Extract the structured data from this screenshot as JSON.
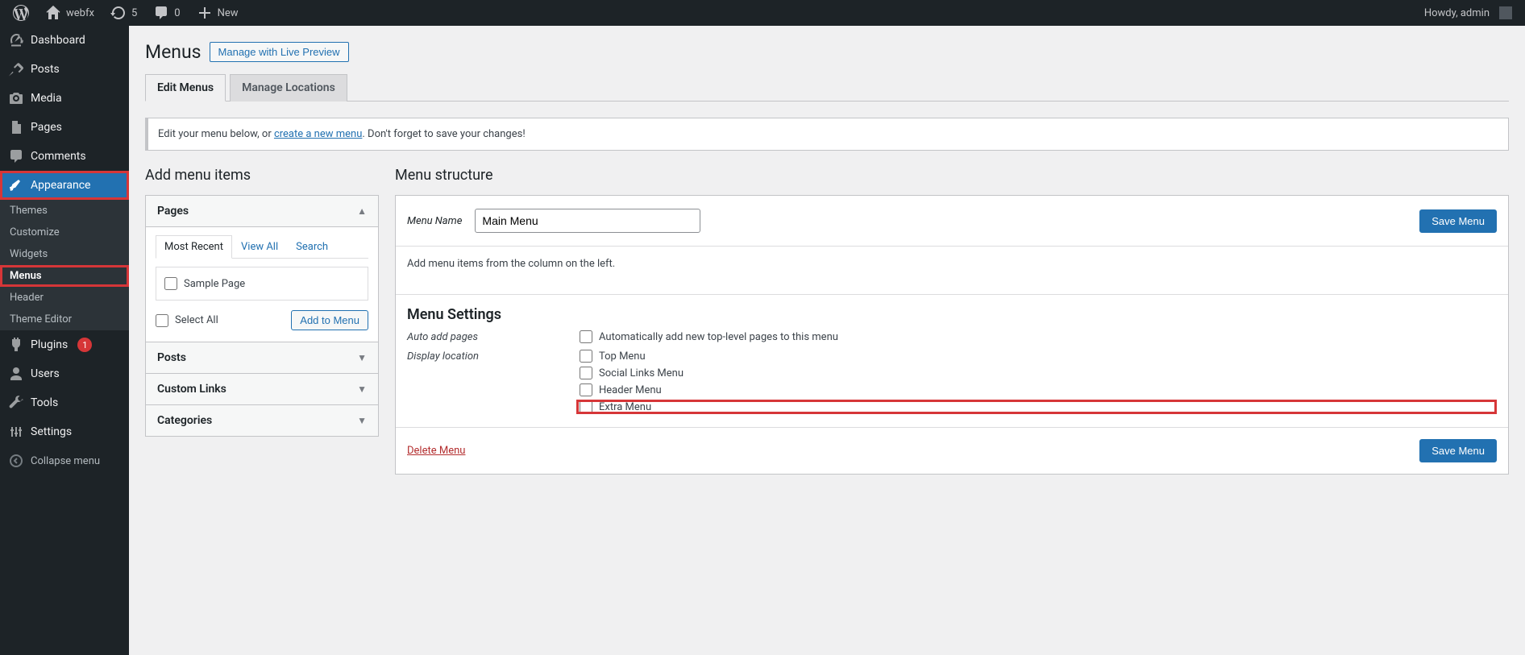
{
  "admin_bar": {
    "site_name": "webfx",
    "updates_count": "5",
    "comments_count": "0",
    "new_label": "New",
    "howdy": "Howdy, admin"
  },
  "sidebar": {
    "dashboard": "Dashboard",
    "posts": "Posts",
    "media": "Media",
    "pages": "Pages",
    "comments": "Comments",
    "appearance": "Appearance",
    "appearance_sub": {
      "themes": "Themes",
      "customize": "Customize",
      "widgets": "Widgets",
      "menus": "Menus",
      "header": "Header",
      "theme_editor": "Theme Editor"
    },
    "plugins": "Plugins",
    "plugins_badge": "1",
    "users": "Users",
    "tools": "Tools",
    "settings": "Settings",
    "collapse": "Collapse menu"
  },
  "page": {
    "title": "Menus",
    "preview_btn": "Manage with Live Preview",
    "tabs": {
      "edit": "Edit Menus",
      "locations": "Manage Locations"
    },
    "notice_pre": "Edit your menu below, or ",
    "notice_link": "create a new menu",
    "notice_post": ". Don't forget to save your changes!"
  },
  "add_items": {
    "title": "Add menu items",
    "pages": {
      "header": "Pages",
      "tabs": {
        "recent": "Most Recent",
        "view_all": "View All",
        "search": "Search"
      },
      "item1": "Sample Page",
      "select_all": "Select All",
      "add_btn": "Add to Menu"
    },
    "posts": "Posts",
    "custom_links": "Custom Links",
    "categories": "Categories"
  },
  "structure": {
    "title": "Menu structure",
    "name_label": "Menu Name",
    "name_value": "Main Menu",
    "save_btn": "Save Menu",
    "instructions": "Add menu items from the column on the left.",
    "settings_title": "Menu Settings",
    "auto_add_label": "Auto add pages",
    "auto_add_option": "Automatically add new top-level pages to this menu",
    "display_label": "Display location",
    "locations": {
      "top": "Top Menu",
      "social": "Social Links Menu",
      "header": "Header Menu",
      "extra": "Extra Menu"
    },
    "delete": "Delete Menu"
  }
}
